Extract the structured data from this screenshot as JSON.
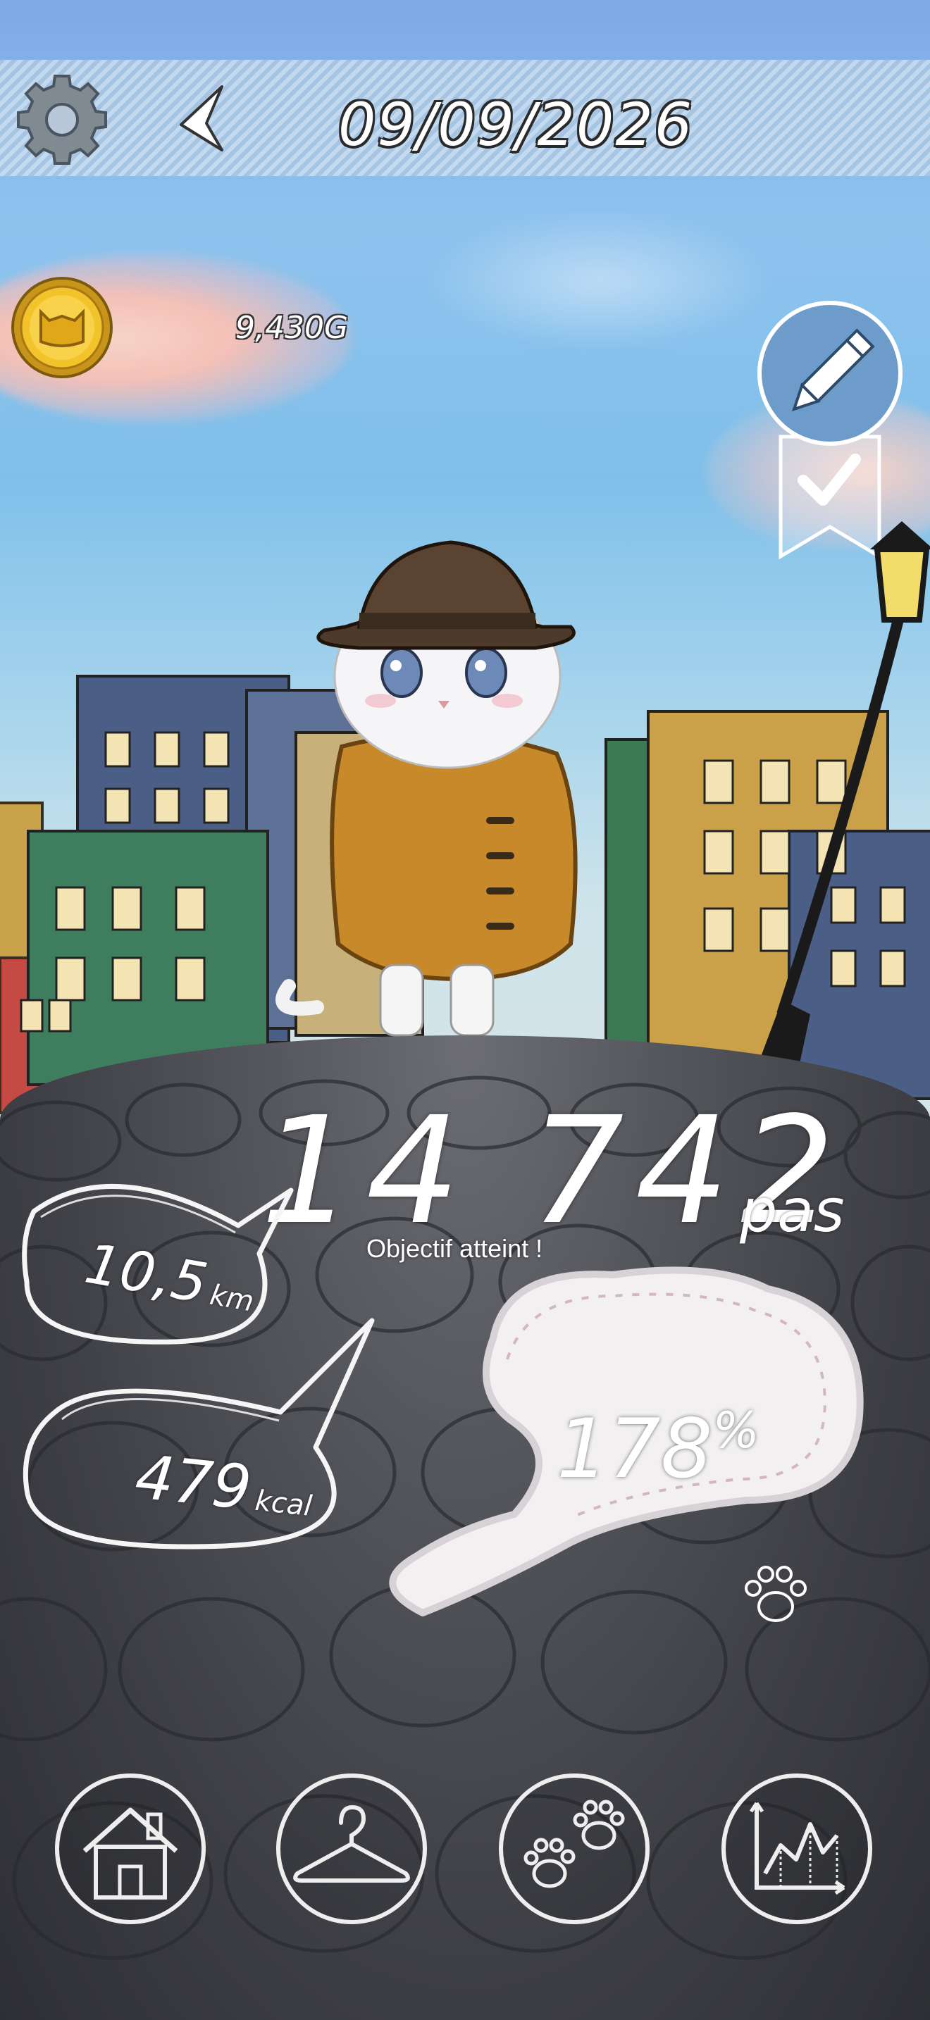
{
  "header": {
    "date": "09/09/2026"
  },
  "wallet": {
    "coins": "9,430G"
  },
  "stats": {
    "steps": "14 742",
    "steps_unit": "pas",
    "goal_status": "Objectif atteint !",
    "distance_value": "10,5",
    "distance_unit": "km",
    "calories_value": "479",
    "calories_unit": "kcal",
    "goal_percent": "178",
    "percent_sign": "%"
  },
  "nav": {
    "items": [
      {
        "icon": "house-icon"
      },
      {
        "icon": "hanger-icon"
      },
      {
        "icon": "paw-prints-icon"
      },
      {
        "icon": "chart-icon"
      }
    ]
  },
  "colors": {
    "sky": "#8fc3ee",
    "ground": "#4a4b51",
    "coin": "#e8b820",
    "text": "#ffffff"
  }
}
